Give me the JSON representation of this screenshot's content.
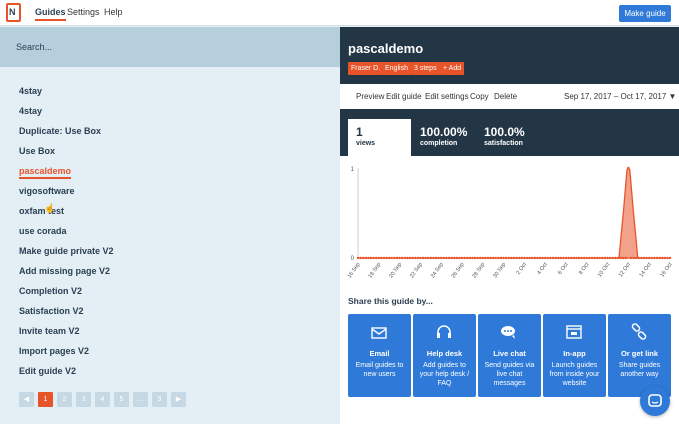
{
  "logo": {
    "text": "N"
  },
  "nav": [
    {
      "label": "Guides"
    },
    {
      "label": "Settings"
    },
    {
      "label": "Help"
    }
  ],
  "make_guide_label": "Make guide",
  "search": {
    "placeholder": "Search..."
  },
  "guides": [
    "4stay",
    "4stay",
    "Duplicate: Use Box",
    "Use Box",
    "pascaldemo",
    "vigosoftware",
    "oxfam test",
    "use corada",
    "Make guide private V2",
    "Add missing page V2",
    "Completion V2",
    "Satisfaction V2",
    "Invite team V2",
    "Import pages V2",
    "Edit guide V2"
  ],
  "active_guide": "pascaldemo",
  "pagination": {
    "prev": "◀",
    "pages": [
      "1",
      "2",
      "3",
      "4",
      "5",
      "…",
      "9"
    ],
    "next": "▶",
    "current": "1"
  },
  "detail": {
    "title": "pascaldemo",
    "tags": [
      "Fraser D.",
      "English",
      "3 steps",
      "+ Add"
    ],
    "actions": [
      "Preview",
      "Edit guide",
      "Edit settings",
      "Copy",
      "Delete"
    ],
    "date_range": "Sep 17, 2017 – Oct 17, 2017 ▼",
    "stats": [
      {
        "value": "1",
        "label": "views"
      },
      {
        "value": "100.00%",
        "label": "completion"
      },
      {
        "value": "100.0%",
        "label": "satisfaction"
      }
    ]
  },
  "chart_data": {
    "type": "area",
    "x": [
      "16 Sep",
      "18 Sep",
      "20 Sep",
      "22 Sep",
      "24 Sep",
      "26 Sep",
      "28 Sep",
      "30 Sep",
      "2 Oct",
      "4 Oct",
      "6 Oct",
      "8 Oct",
      "10 Oct",
      "12 Oct",
      "14 Oct",
      "16 Oct"
    ],
    "y": [
      0,
      0,
      0,
      0,
      0,
      0,
      0,
      0,
      0,
      0,
      0,
      0,
      0,
      1,
      0,
      0
    ],
    "y_ticks": [
      "1",
      "0"
    ],
    "ylim": [
      0,
      1
    ],
    "color": "#e8542a"
  },
  "share": {
    "title": "Share this guide by...",
    "cards": [
      {
        "icon": "email-icon",
        "title": "Email",
        "desc": "Email guides to new users"
      },
      {
        "icon": "headset-icon",
        "title": "Help desk",
        "desc": "Add guides to your help desk / FAQ"
      },
      {
        "icon": "chat-bubbles-icon",
        "title": "Live chat",
        "desc": "Send guides via live chat messages"
      },
      {
        "icon": "app-window-icon",
        "title": "In-app",
        "desc": "Launch guides from inside your website"
      },
      {
        "icon": "link-icon",
        "title": "Or get link",
        "desc": "Share guides another way"
      }
    ]
  },
  "colors": {
    "accent": "#e8542a",
    "primary": "#2f7ad8",
    "dark": "#233646"
  }
}
